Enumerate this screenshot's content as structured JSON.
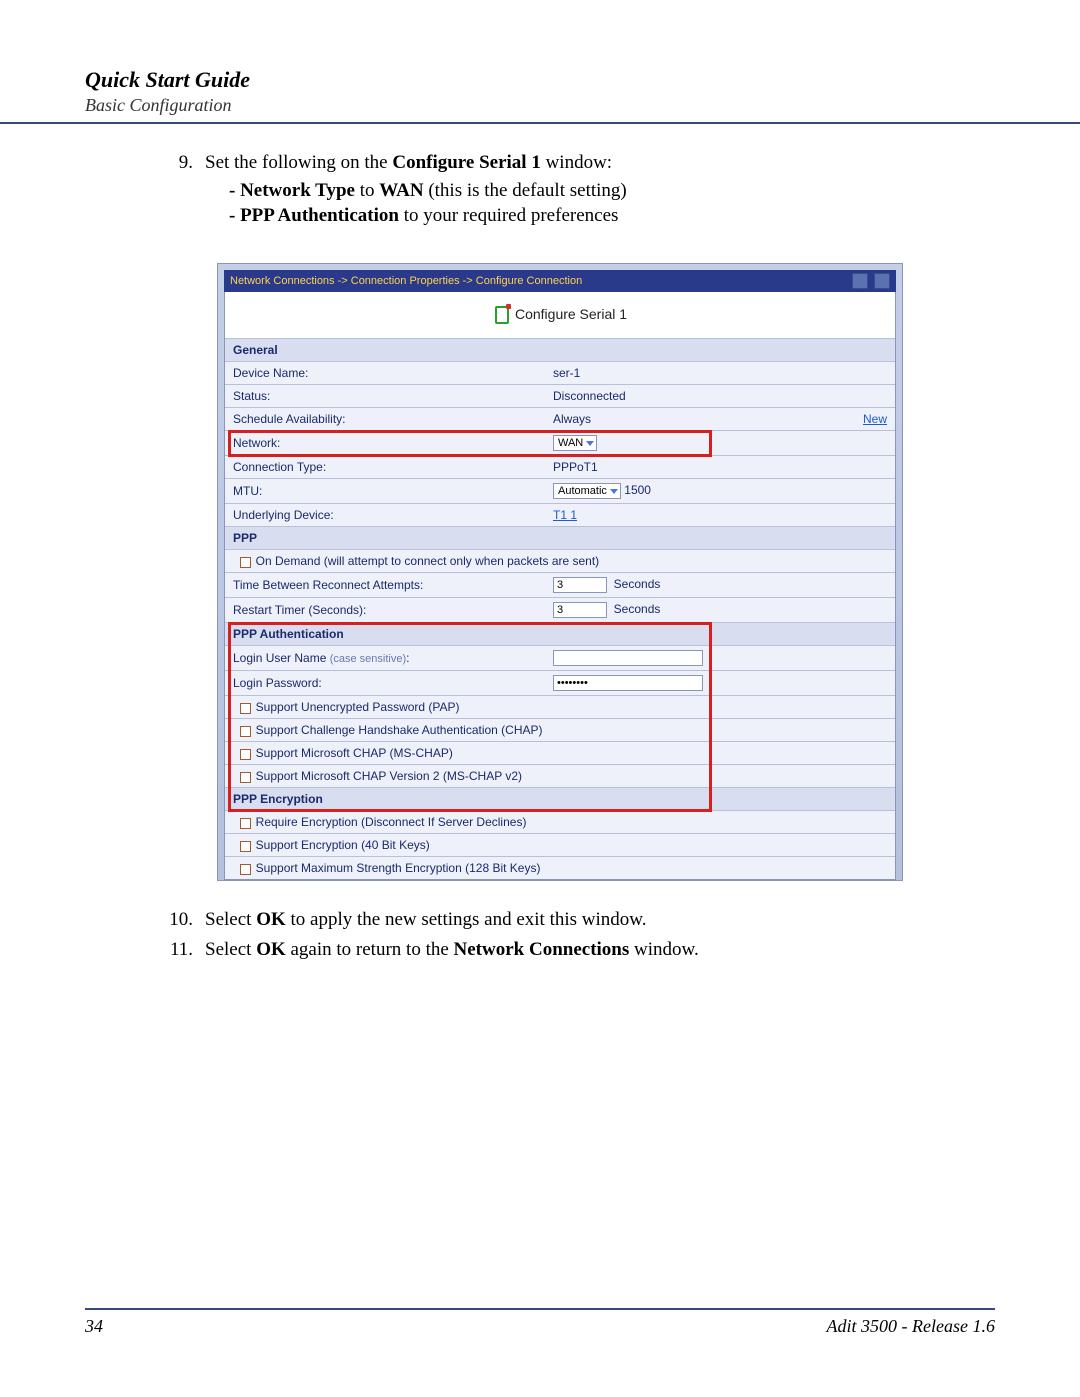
{
  "header": {
    "title": "Quick Start Guide",
    "subtitle": "Basic Configuration"
  },
  "steps": {
    "s9": {
      "num": "9.",
      "text_prefix": "Set the following on the ",
      "text_bold": "Configure Serial 1",
      "text_suffix": " window:",
      "sub1_b1": "- Network Type",
      "sub1_mid": " to ",
      "sub1_b2": "WAN",
      "sub1_tail": " (this is the default setting)",
      "sub2_b": "- PPP Authentication",
      "sub2_tail": " to your required preferences"
    },
    "s10": {
      "num": "10.",
      "t1": "Select ",
      "b1": "OK",
      "t2": " to apply the new settings and exit this window."
    },
    "s11": {
      "num": "11.",
      "t1": "Select ",
      "b1": "OK",
      "t2": " again to return to the ",
      "b2": "Network Connections",
      "t3": " window."
    }
  },
  "screenshot": {
    "breadcrumb": "Network Connections -> Connection Properties -> Configure Connection",
    "title": "Configure Serial 1",
    "sections": {
      "general": "General",
      "ppp": "PPP",
      "ppp_auth": "PPP Authentication",
      "ppp_enc": "PPP Encryption"
    },
    "rows": {
      "device_name_l": "Device Name:",
      "device_name_v": "ser-1",
      "status_l": "Status:",
      "status_v": "Disconnected",
      "sched_l": "Schedule Availability:",
      "sched_v": "Always",
      "sched_new": "New",
      "network_l": "Network:",
      "network_v": "WAN",
      "conn_type_l": "Connection Type:",
      "conn_type_v": "PPPoT1",
      "mtu_l": "MTU:",
      "mtu_dd": "Automatic",
      "mtu_val": "1500",
      "underlying_l": "Underlying Device:",
      "underlying_v": "T1 1",
      "ondemand": "On Demand (will attempt to connect only when packets are sent)",
      "reconnect_l": "Time Between Reconnect Attempts:",
      "reconnect_v": "3",
      "seconds": "Seconds",
      "restart_l": "Restart Timer (Seconds):",
      "restart_v": "3",
      "login_user_l": "Login User Name ",
      "login_user_note": "(case sensitive)",
      "login_user_colon": ":",
      "login_pass_l": "Login Password:",
      "login_pass_v": "••••••••",
      "pap": "Support Unencrypted Password (PAP)",
      "chap": "Support Challenge Handshake Authentication (CHAP)",
      "mschap": "Support Microsoft CHAP (MS-CHAP)",
      "mschap2": "Support Microsoft CHAP Version 2 (MS-CHAP v2)",
      "req_enc": "Require Encryption (Disconnect If Server Declines)",
      "enc40": "Support Encryption (40 Bit Keys)",
      "enc128": "Support Maximum Strength Encryption (128 Bit Keys)"
    }
  },
  "footer": {
    "page": "34",
    "product": "Adit 3500  - Release 1.6"
  }
}
